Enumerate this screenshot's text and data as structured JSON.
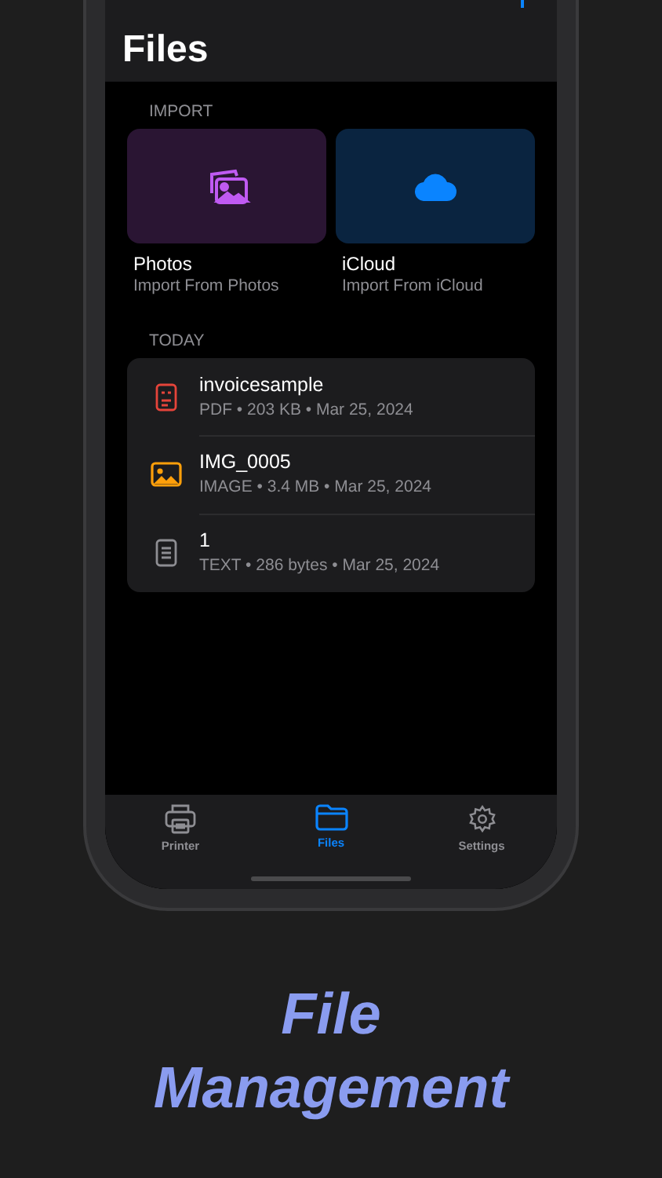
{
  "header": {
    "title": "Files"
  },
  "import_section": {
    "label": "IMPORT",
    "sources": [
      {
        "kind": "photos",
        "name": "Photos",
        "subtitle": "Import From Photos"
      },
      {
        "kind": "icloud",
        "name": "iCloud",
        "subtitle": "Import From iCloud"
      }
    ]
  },
  "today_section": {
    "label": "TODAY",
    "files": [
      {
        "kind": "pdf",
        "name": "invoicesample",
        "details": "PDF • 203 KB • Mar 25, 2024"
      },
      {
        "kind": "image",
        "name": "IMG_0005",
        "details": "IMAGE • 3.4 MB • Mar 25, 2024"
      },
      {
        "kind": "text",
        "name": "1",
        "details": "TEXT • 286 bytes • Mar 25, 2024"
      }
    ]
  },
  "tabs": [
    {
      "kind": "printer",
      "label": "Printer",
      "selected": false
    },
    {
      "kind": "files",
      "label": "Files",
      "selected": true
    },
    {
      "kind": "settings",
      "label": "Settings",
      "selected": false
    }
  ],
  "headline": [
    "File",
    "Management"
  ]
}
